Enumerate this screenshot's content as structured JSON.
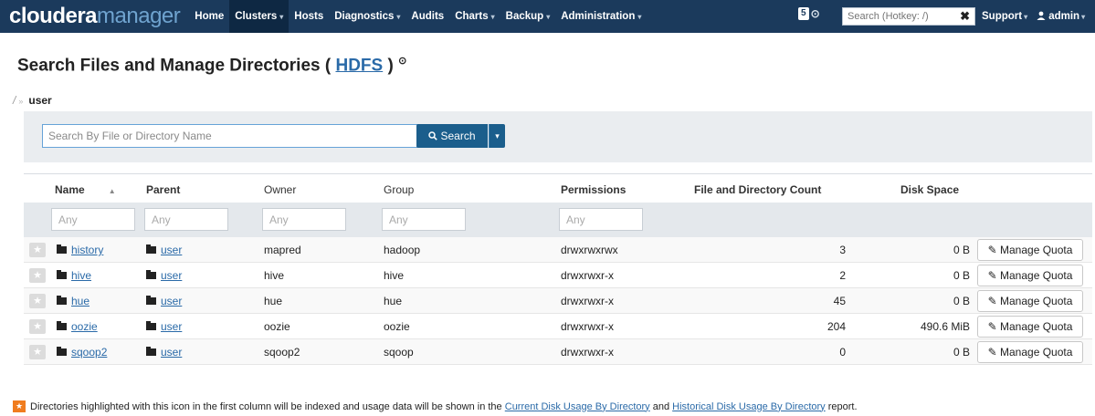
{
  "navbar": {
    "logo_part1": "cloudera",
    "logo_part2": "manager",
    "items": [
      {
        "label": "Home",
        "caret": false
      },
      {
        "label": "Clusters",
        "caret": true
      },
      {
        "label": "Hosts",
        "caret": false
      },
      {
        "label": "Diagnostics",
        "caret": true
      },
      {
        "label": "Audits",
        "caret": false
      },
      {
        "label": "Charts",
        "caret": true
      },
      {
        "label": "Backup",
        "caret": true
      },
      {
        "label": "Administration",
        "caret": true
      }
    ],
    "active_item": "Clusters",
    "alert_count": "5",
    "search_placeholder": "Search (Hotkey: /)",
    "clear_symbol": "✖",
    "support_label": "Support",
    "admin_label": "admin",
    "caret": "▾"
  },
  "page": {
    "title": "Search Files and Manage Directories (",
    "title_link": "HDFS",
    "title_end": ")",
    "help_icon": "⊙"
  },
  "breadcrumb": {
    "root": "/",
    "separator": "»",
    "current": "user"
  },
  "search": {
    "placeholder": "Search By File or Directory Name",
    "button_label": "Search",
    "button_icon": "🔍",
    "caret": "▾"
  },
  "table": {
    "headers": {
      "name": "Name",
      "parent": "Parent",
      "owner": "Owner",
      "group": "Group",
      "permissions": "Permissions",
      "count": "File and Directory Count",
      "disk_space": "Disk Space",
      "sort_indicator": "▲"
    },
    "filter_placeholder": "Any",
    "rows": [
      {
        "name": "history",
        "parent": "user",
        "owner": "mapred",
        "group": "hadoop",
        "permissions": "drwxrwxrwx",
        "count": "3",
        "disk_space": "0 B",
        "action": "Manage Quota"
      },
      {
        "name": "hive",
        "parent": "user",
        "owner": "hive",
        "group": "hive",
        "permissions": "drwxrwxr-x",
        "count": "2",
        "disk_space": "0 B",
        "action": "Manage Quota"
      },
      {
        "name": "hue",
        "parent": "user",
        "owner": "hue",
        "group": "hue",
        "permissions": "drwxrwxr-x",
        "count": "45",
        "disk_space": "0 B",
        "action": "Manage Quota"
      },
      {
        "name": "oozie",
        "parent": "user",
        "owner": "oozie",
        "group": "oozie",
        "permissions": "drwxrwxr-x",
        "count": "204",
        "disk_space": "490.6 MiB",
        "action": "Manage Quota"
      },
      {
        "name": "sqoop2",
        "parent": "user",
        "owner": "sqoop2",
        "group": "sqoop",
        "permissions": "drwxrwxr-x",
        "count": "0",
        "disk_space": "0 B",
        "action": "Manage Quota"
      }
    ],
    "edit_icon": "✎",
    "star_icon": "★"
  },
  "footnote": {
    "text_before": "Directories highlighted with this icon in the first column will be indexed and usage data will be shown in the",
    "link1": "Current Disk Usage By Directory",
    "text_middle": "and",
    "link2": "Historical Disk Usage By Directory",
    "text_after": "report."
  }
}
